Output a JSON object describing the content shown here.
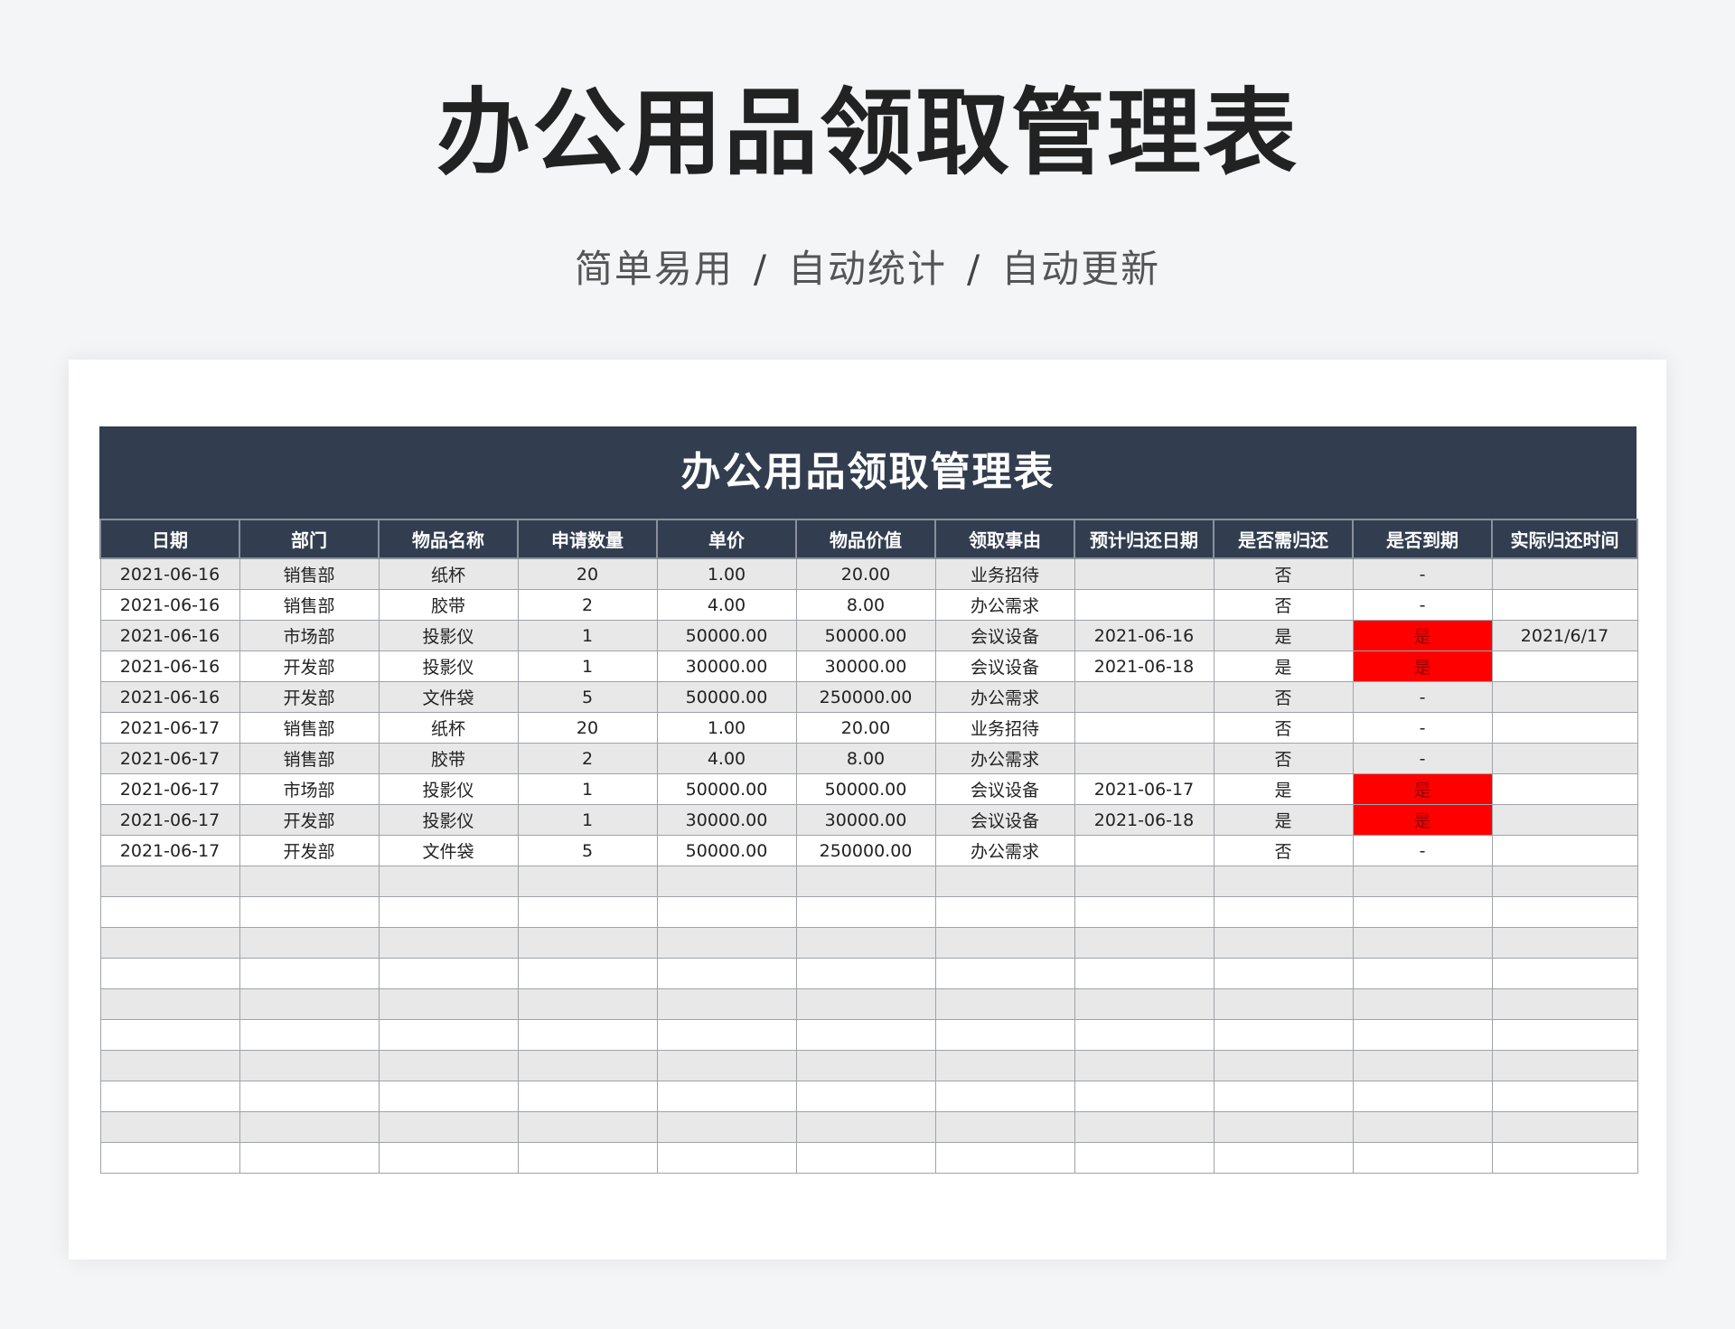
{
  "hero": {
    "title": "办公用品领取管理表",
    "tagline": [
      "简单易用",
      "自动统计",
      "自动更新"
    ],
    "separator": "/"
  },
  "sheet": {
    "banner_title": "办公用品领取管理表",
    "columns": [
      "日期",
      "部门",
      "物品名称",
      "申请数量",
      "单价",
      "物品价值",
      "领取事由",
      "预计归还日期",
      "是否需归还",
      "是否到期",
      "实际归还时间"
    ],
    "rows": [
      [
        "2021-06-16",
        "销售部",
        "纸杯",
        "20",
        "1.00",
        "20.00",
        "业务招待",
        "",
        "否",
        "-",
        ""
      ],
      [
        "2021-06-16",
        "销售部",
        "胶带",
        "2",
        "4.00",
        "8.00",
        "办公需求",
        "",
        "否",
        "-",
        ""
      ],
      [
        "2021-06-16",
        "市场部",
        "投影仪",
        "1",
        "50000.00",
        "50000.00",
        "会议设备",
        "2021-06-16",
        "是",
        "是",
        "2021/6/17"
      ],
      [
        "2021-06-16",
        "开发部",
        "投影仪",
        "1",
        "30000.00",
        "30000.00",
        "会议设备",
        "2021-06-18",
        "是",
        "是",
        ""
      ],
      [
        "2021-06-16",
        "开发部",
        "文件袋",
        "5",
        "50000.00",
        "250000.00",
        "办公需求",
        "",
        "否",
        "-",
        ""
      ],
      [
        "2021-06-17",
        "销售部",
        "纸杯",
        "20",
        "1.00",
        "20.00",
        "业务招待",
        "",
        "否",
        "-",
        ""
      ],
      [
        "2021-06-17",
        "销售部",
        "胶带",
        "2",
        "4.00",
        "8.00",
        "办公需求",
        "",
        "否",
        "-",
        ""
      ],
      [
        "2021-06-17",
        "市场部",
        "投影仪",
        "1",
        "50000.00",
        "50000.00",
        "会议设备",
        "2021-06-17",
        "是",
        "是",
        ""
      ],
      [
        "2021-06-17",
        "开发部",
        "投影仪",
        "1",
        "30000.00",
        "30000.00",
        "会议设备",
        "2021-06-18",
        "是",
        "是",
        ""
      ],
      [
        "2021-06-17",
        "开发部",
        "文件袋",
        "5",
        "50000.00",
        "250000.00",
        "办公需求",
        "",
        "否",
        "-",
        ""
      ]
    ],
    "blank_rows": 10,
    "alert_value": "是",
    "alert_color": "#ff0000",
    "header_color": "#323e50",
    "stripe_color": "#e8e8e8"
  }
}
